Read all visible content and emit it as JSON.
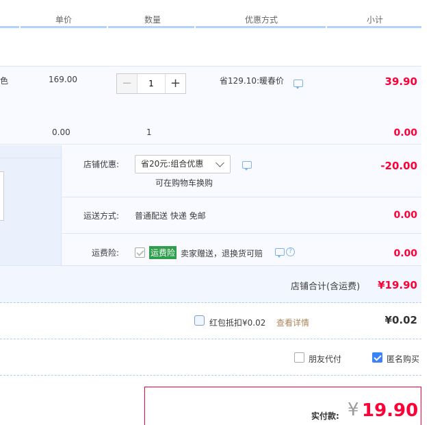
{
  "header": {
    "unit_price": "单价",
    "quantity": "数量",
    "discount": "优惠方式",
    "subtotal": "小计"
  },
  "item1": {
    "color_fragment": "色",
    "price": "169.00",
    "quantity": "1",
    "discount_text": "省129.10:暖春价",
    "subtotal": "39.90"
  },
  "item2": {
    "price": "0.00",
    "quantity": "1",
    "subtotal": "0.00"
  },
  "shop": {
    "discount_label": "店铺优惠:",
    "discount_select": "省20元:组合优惠",
    "discount_note": "可在购物车换购",
    "discount_value": "-20.00",
    "shipping_label": "运送方式:",
    "shipping_value": "普通配送 快递 免邮",
    "shipping_cost": "0.00",
    "insurance_label": "运费险:",
    "insurance_badge": "运费险",
    "insurance_text": "卖家赠送，退换货可赔",
    "insurance_cost": "0.00",
    "total_label": "店铺合计(含运费)",
    "total_value": "¥19.90"
  },
  "redpacket": {
    "label": "红包抵扣¥0.02",
    "details_link": "查看详情",
    "value": "¥0.02"
  },
  "options": {
    "friend_pay": "朋友代付",
    "anonymous": "匿名购买"
  },
  "payment": {
    "label": "实付款:",
    "currency": "¥",
    "amount": "19.90"
  },
  "colors": {
    "accent_red": "#ff0036",
    "header_line": "#b2d1ff",
    "row_bg": "#f8faff",
    "checkbox_blue": "#3b82f6"
  }
}
